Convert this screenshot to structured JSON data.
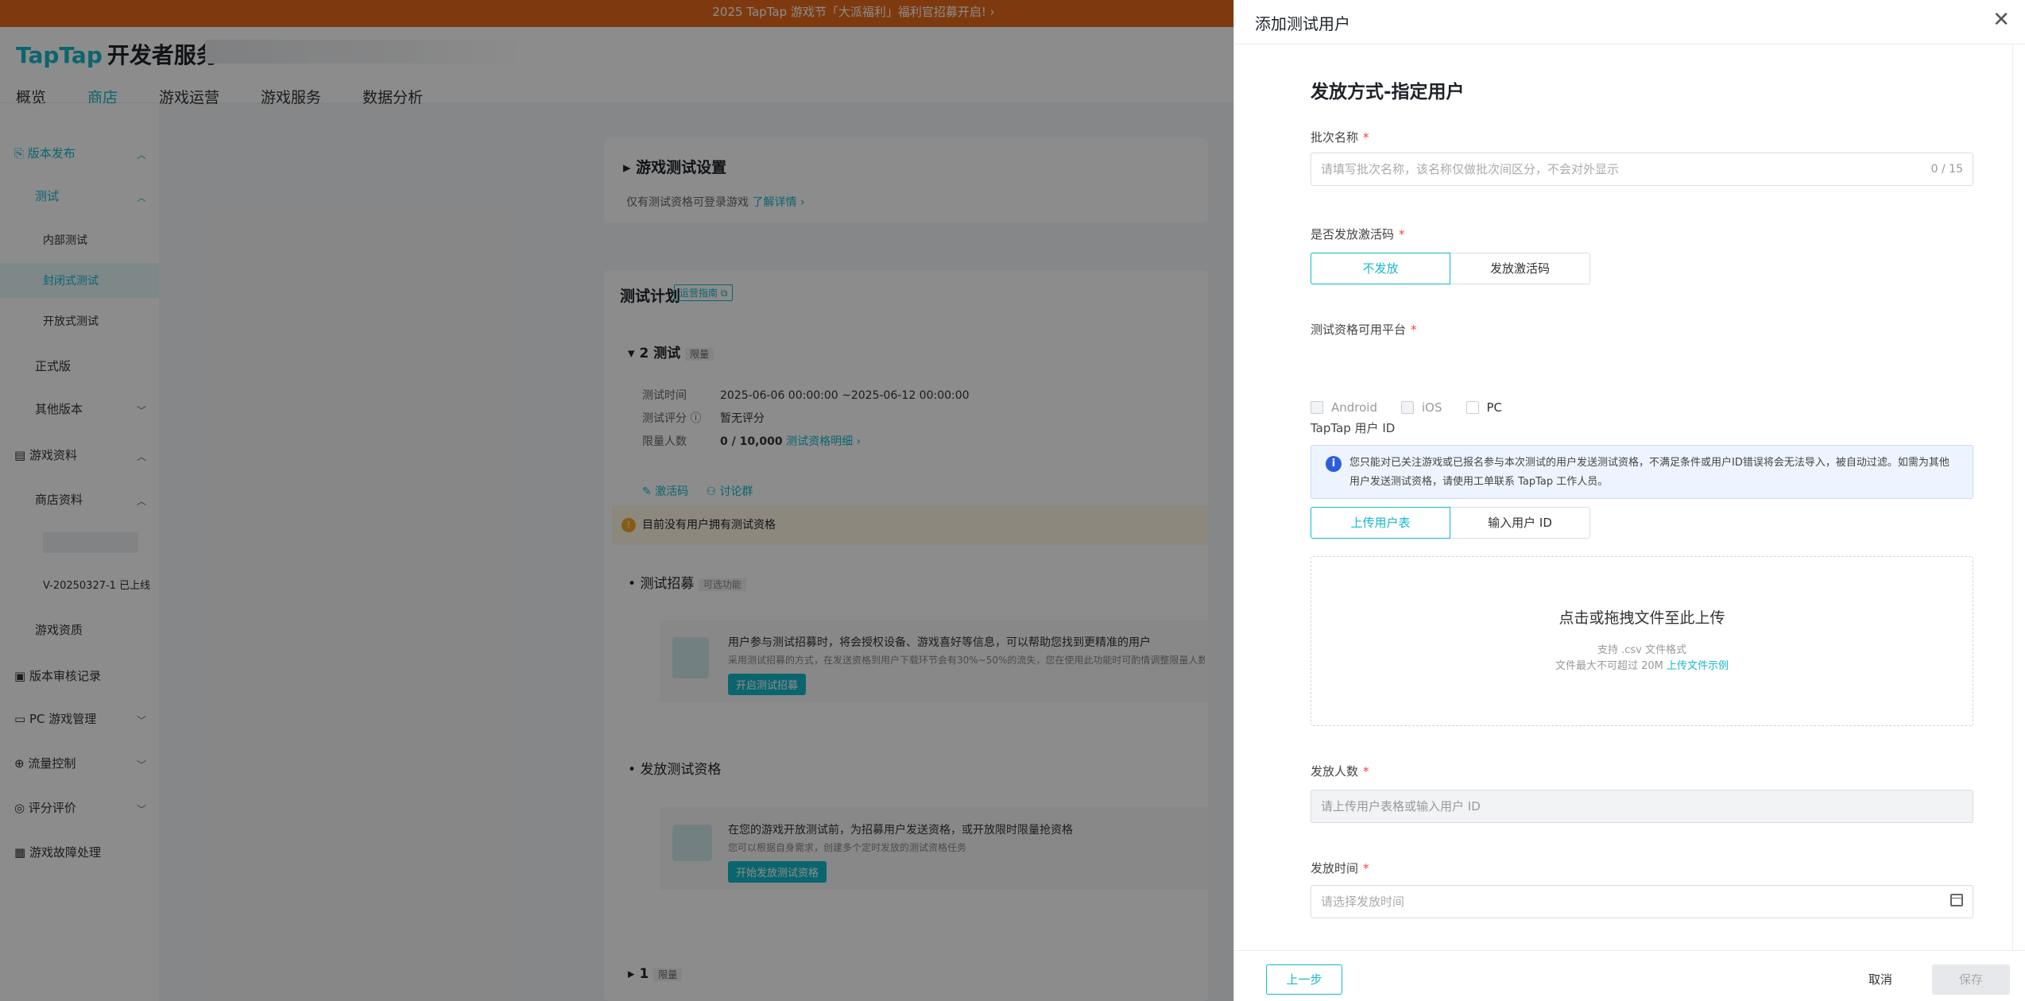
{
  "banner": {
    "text": "2025 TapTap 游戏节「大派福利」福利官招募开启! ›"
  },
  "header": {
    "logo": "TapTap",
    "logo_suffix": "开发者服务"
  },
  "nav": [
    "概览",
    "商店",
    "游戏运营",
    "游戏服务",
    "数据分析"
  ],
  "sidebar": {
    "version_release": "版本发布",
    "test": "测试",
    "internal_test": "内部测试",
    "closed_test": "封闭式测试",
    "open_test": "开放式测试",
    "official": "正式版",
    "other_versions": "其他版本",
    "game_info": "游戏资料",
    "store_info": "商店资料",
    "version_tag": "V-20250327-1 已上线",
    "game_assets": "游戏资质",
    "review_records": "版本审核记录",
    "pc_management": "PC 游戏管理",
    "traffic_control": "流量控制",
    "ratings": "评分评价",
    "fault_handling": "游戏故障处理"
  },
  "main": {
    "settings_title": "游戏测试设置",
    "settings_desc": "仅有测试资格可登录游戏",
    "settings_link": "了解详情 ›",
    "plan_title": "测试计划",
    "plan_guide": "运营指南",
    "test2_title": "2 测试",
    "test2_badge": "限量",
    "time_label": "测试时间",
    "time_value": "2025-06-06 00:00:00 ~2025-06-12 00:00:00",
    "score_label": "测试评分",
    "score_value": "暂无评分",
    "limit_label": "限量人数",
    "limit_value": "0 / 10,000",
    "limit_link": "测试资格明细 ›",
    "code_link": "激活码",
    "discuss_link": "讨论群",
    "warning": "目前没有用户拥有测试资格",
    "recruit_title": "测试招募",
    "recruit_badge": "可选功能",
    "recruit_desc1": "用户参与测试招募时，将会授权设备、游戏喜好等信息，可以帮助您找到更精准的用户",
    "recruit_desc2": "采用测试招募的方式，在发送资格到用户下载环节会有30%~50%的流失，您在使用此功能时可酌情调整限量人数",
    "recruit_btn": "开启测试招募",
    "issue_title": "发放测试资格",
    "issue_desc1": "在您的游戏开放测试前，为招募用户发送资格，或开放限时限量抢资格",
    "issue_desc2": "您可以根据自身需求，创建多个定时发放的测试资格任务",
    "issue_btn": "开始发放测试资格",
    "test1_title": "1",
    "test1_badge": "限量"
  },
  "drawer": {
    "title": "添加测试用户",
    "section_title": "发放方式-指定用户",
    "batch_name_label": "批次名称",
    "batch_name_placeholder": "请填写批次名称，该名称仅做批次间区分，不会对外显示",
    "batch_name_counter": "0 / 15",
    "activation_label": "是否发放激活码",
    "activation_options": [
      "不发放",
      "发放激活码"
    ],
    "platform_label": "测试资格可用平台",
    "platforms": [
      "Android",
      "iOS",
      "PC"
    ],
    "user_id_label": "TapTap 用户 ID",
    "notice": "您只能对已关注游戏或已报名参与本次测试的用户发送测试资格，不满足条件或用户ID错误将会无法导入，被自动过滤。如需为其他用户发送测试资格，请使用工单联系 TapTap 工作人员。",
    "upload_tabs": [
      "上传用户表",
      "输入用户 ID"
    ],
    "upload_title": "点击或拖拽文件至此上传",
    "upload_sub1": "支持 .csv 文件格式",
    "upload_sub2": "文件最大不可超过 20M",
    "upload_link": "上传文件示例",
    "count_label": "发放人数",
    "count_placeholder": "请上传用户表格或输入用户 ID",
    "time_label": "发放时间",
    "time_placeholder": "请选择发放时间",
    "prev_btn": "上一步",
    "cancel_btn": "取消",
    "save_btn": "保存"
  }
}
